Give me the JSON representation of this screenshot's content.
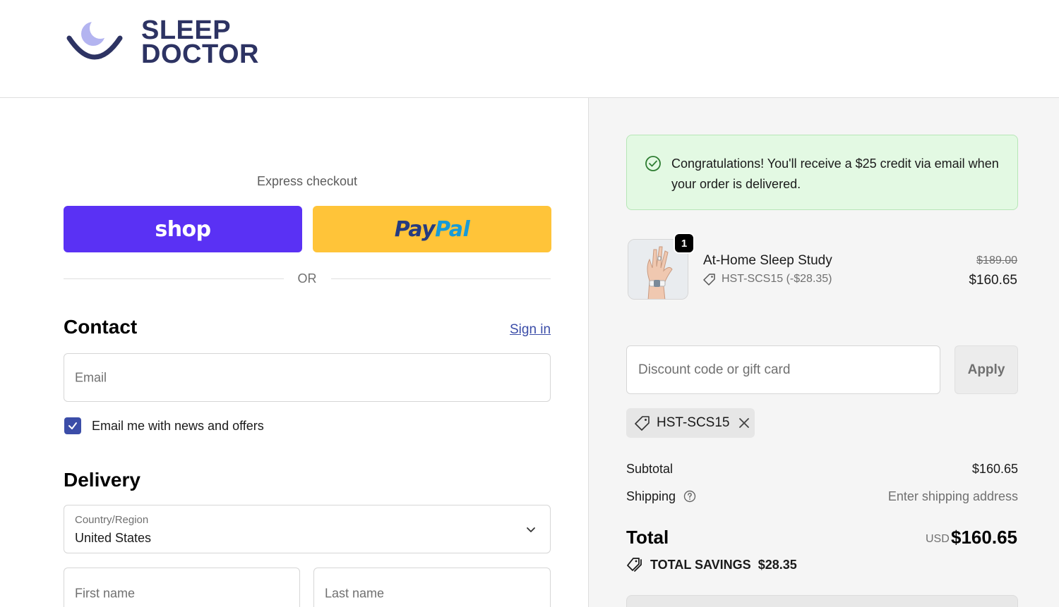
{
  "brand": {
    "line1": "SLEEP",
    "line2": "DOCTOR"
  },
  "express": {
    "label": "Express checkout",
    "shop_label": "shop",
    "paypal_a": "Pay",
    "paypal_b": "Pal",
    "or_label": "OR"
  },
  "contact": {
    "title": "Contact",
    "sign_in": "Sign in",
    "email_placeholder": "Email",
    "newsletter_label": "Email me with news and offers",
    "newsletter_checked": true
  },
  "delivery": {
    "title": "Delivery",
    "country_label": "Country/Region",
    "country_value": "United States",
    "first_name_placeholder": "First name",
    "last_name_placeholder": "Last name"
  },
  "summary": {
    "banner_text": "Congratulations! You'll receive a $25 credit via email when your order is delivered.",
    "product": {
      "quantity": "1",
      "name": "At-Home Sleep Study",
      "discount_line": "HST-SCS15 (-$28.35)",
      "price_original": "$189.00",
      "price_final": "$160.65"
    },
    "discount_placeholder": "Discount code or gift card",
    "apply_label": "Apply",
    "applied_code": "HST-SCS15",
    "subtotal_label": "Subtotal",
    "subtotal_value": "$160.65",
    "shipping_label": "Shipping",
    "shipping_value": "Enter shipping address",
    "total_label": "Total",
    "currency": "USD",
    "total_value": "$160.65",
    "savings_label": "TOTAL SAVINGS",
    "savings_value": "$28.35"
  },
  "colors": {
    "shop_pay": "#5a31f4",
    "paypal_yellow": "#ffc439",
    "brand_navy": "#2d3363",
    "link": "#3b4da8",
    "banner_bg": "#e3f9e3"
  }
}
